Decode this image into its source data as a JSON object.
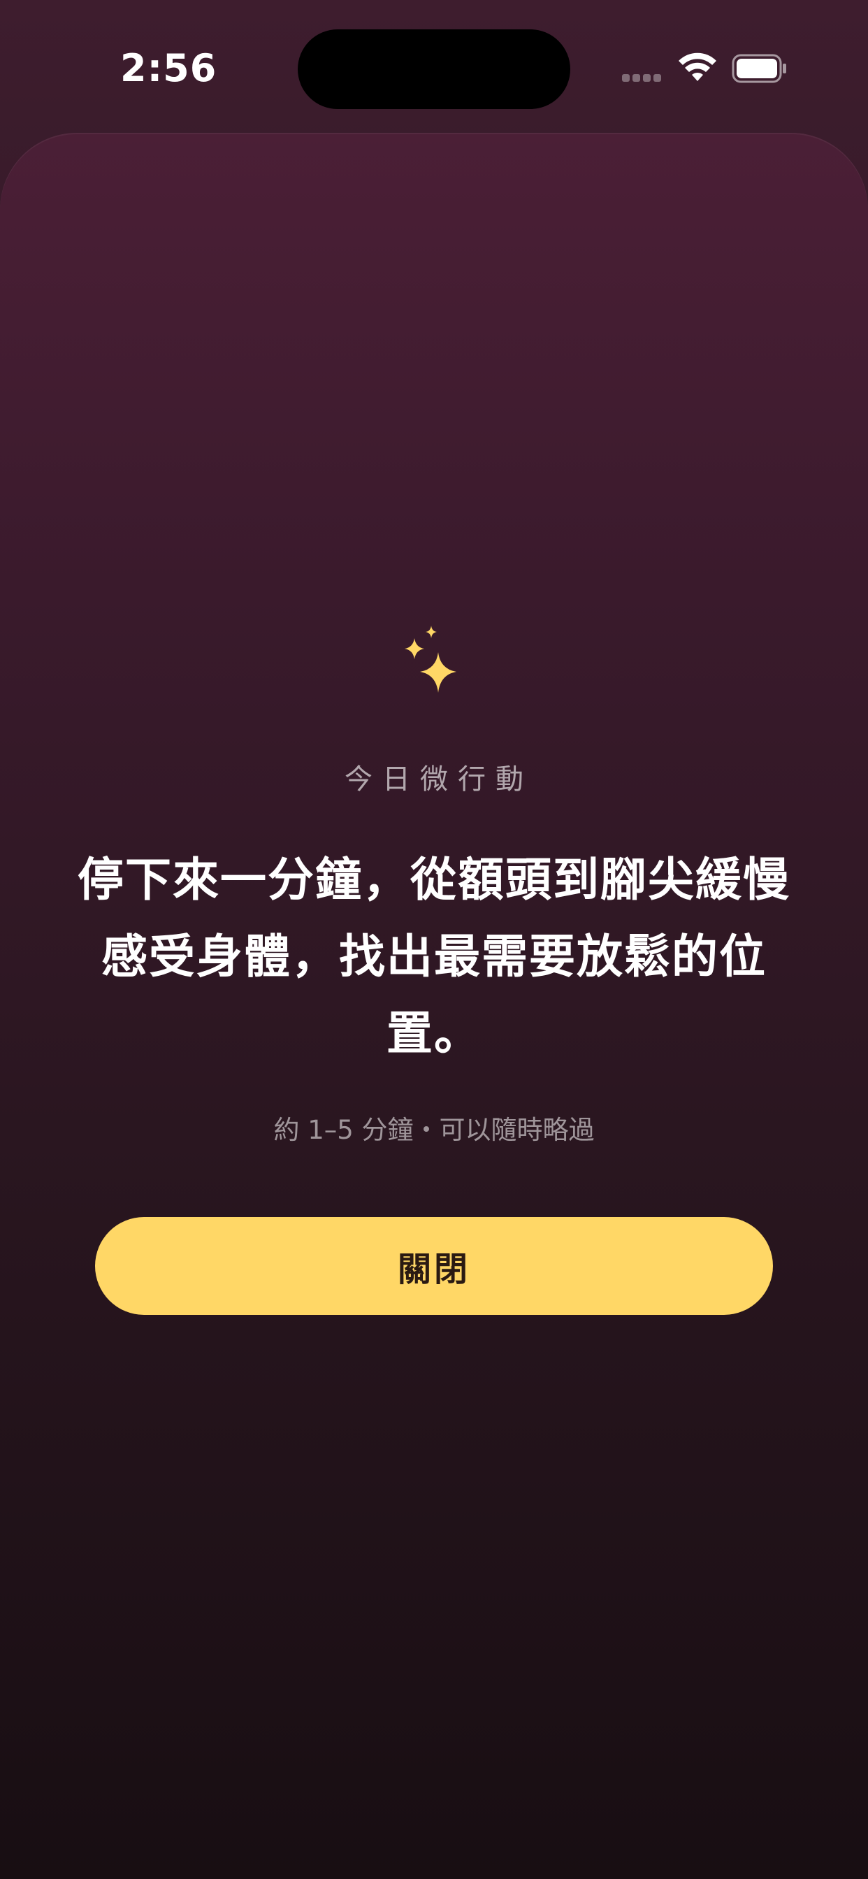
{
  "status_bar": {
    "time": "2:56"
  },
  "colors": {
    "accent": "#ffd766",
    "background_top": "#4b1f36",
    "background_bottom": "#160d11"
  },
  "card": {
    "icon": "sparkles-icon",
    "eyebrow": "今日微行動",
    "message": "停下來一分鐘，從額頭到腳尖緩慢感受身體，找出最需要放鬆的位置。",
    "meta": "約 1–5 分鐘・可以隨時略過",
    "close_label": "關閉"
  }
}
